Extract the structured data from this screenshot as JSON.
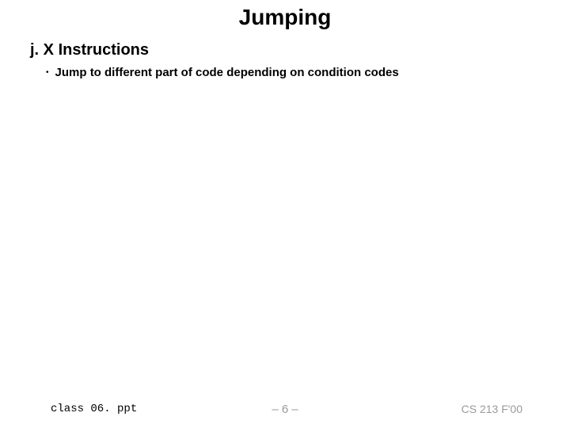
{
  "title": "Jumping",
  "section": "j. X Instructions",
  "bullets": [
    {
      "text": "Jump to different part of code depending on condition codes"
    }
  ],
  "footer": {
    "left": "class 06. ppt",
    "center": "– 6 –",
    "right": "CS 213 F'00"
  }
}
